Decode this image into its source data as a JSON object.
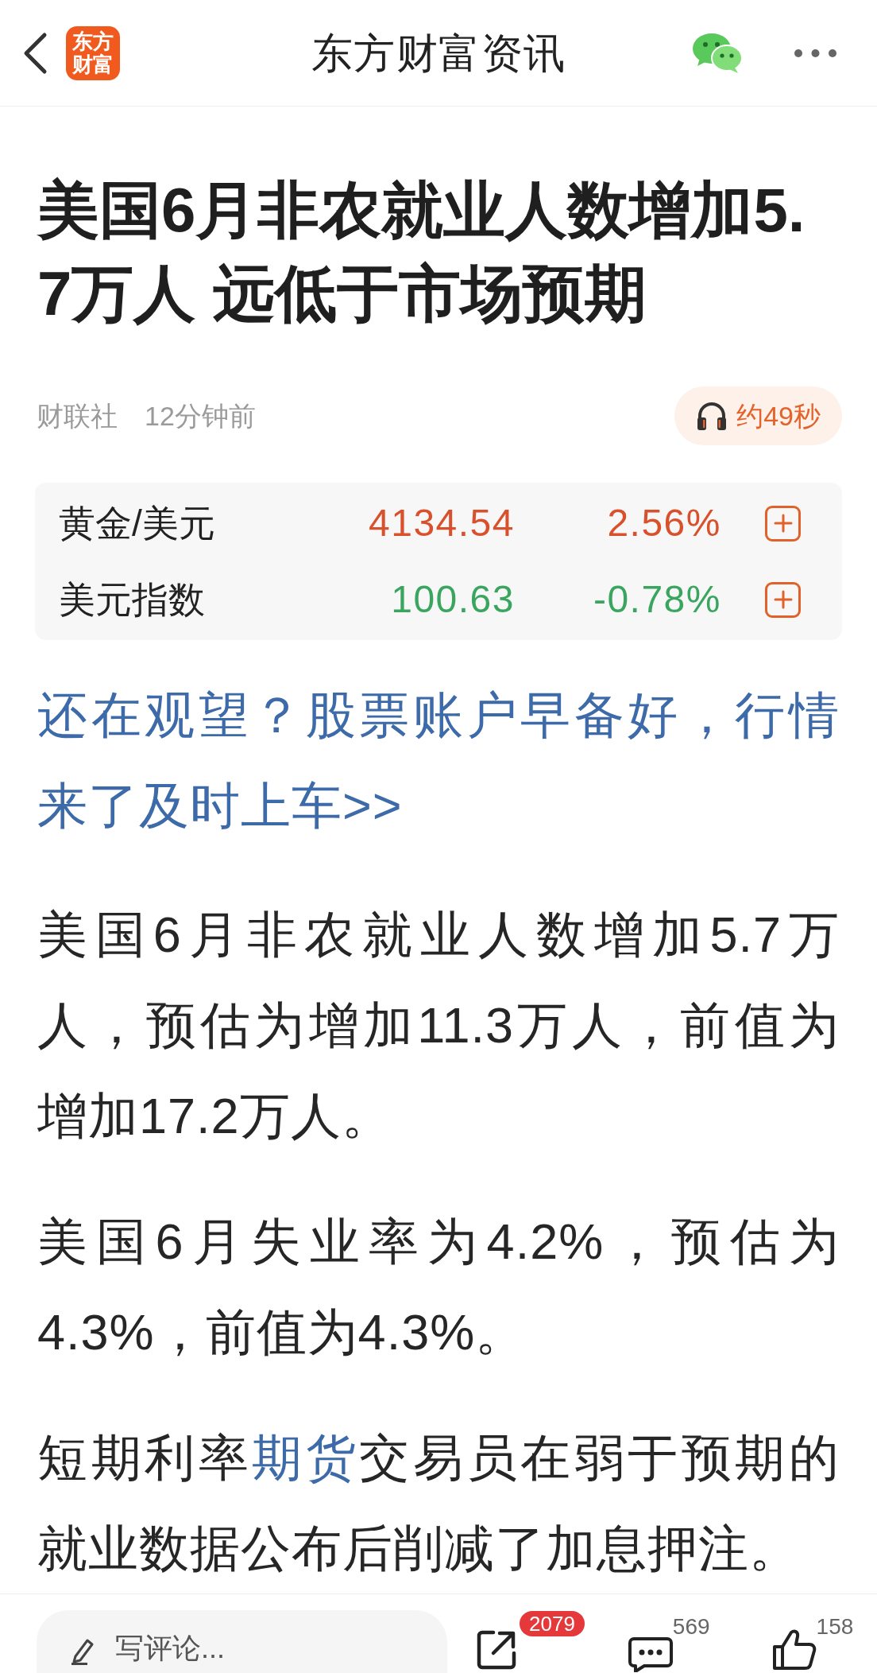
{
  "header": {
    "logo_text": [
      "东方",
      "财富"
    ],
    "title": "东方财富资讯"
  },
  "article": {
    "headline": "美国6月非农就业人数增加5.7万人 远低于市场预期",
    "source": "财联社",
    "time": "12分钟前",
    "audio_duration": "约49秒"
  },
  "quotes": [
    {
      "name": "黄金/美元",
      "price": "4134.54",
      "change": "2.56%",
      "rising": true
    },
    {
      "name": "美元指数",
      "price": "100.63",
      "change": "-0.78%",
      "rising": false
    }
  ],
  "promo_link": "还在观望？股票账户早备好，行情来了及时上车>>",
  "paragraphs": [
    {
      "segments": [
        {
          "kind": "text",
          "text": "美国6月非农就业人数增加5.7万人，预估为增加11.3万人，前值为增加17.2万人。"
        }
      ]
    },
    {
      "segments": [
        {
          "kind": "text",
          "text": "美国6月失业率为4.2%，预估为4.3%，前值为4.3%。"
        }
      ]
    },
    {
      "segments": [
        {
          "kind": "text",
          "text": "短期利率"
        },
        {
          "kind": "link",
          "text": "期货"
        },
        {
          "kind": "text",
          "text": "交易员在弱于预期的就业数据公布后削减了加息押注。"
        }
      ]
    }
  ],
  "bottom_bar": {
    "comment_placeholder": "写评论...",
    "share_count": "2079",
    "comment_count": "569",
    "like_count": "158"
  }
}
